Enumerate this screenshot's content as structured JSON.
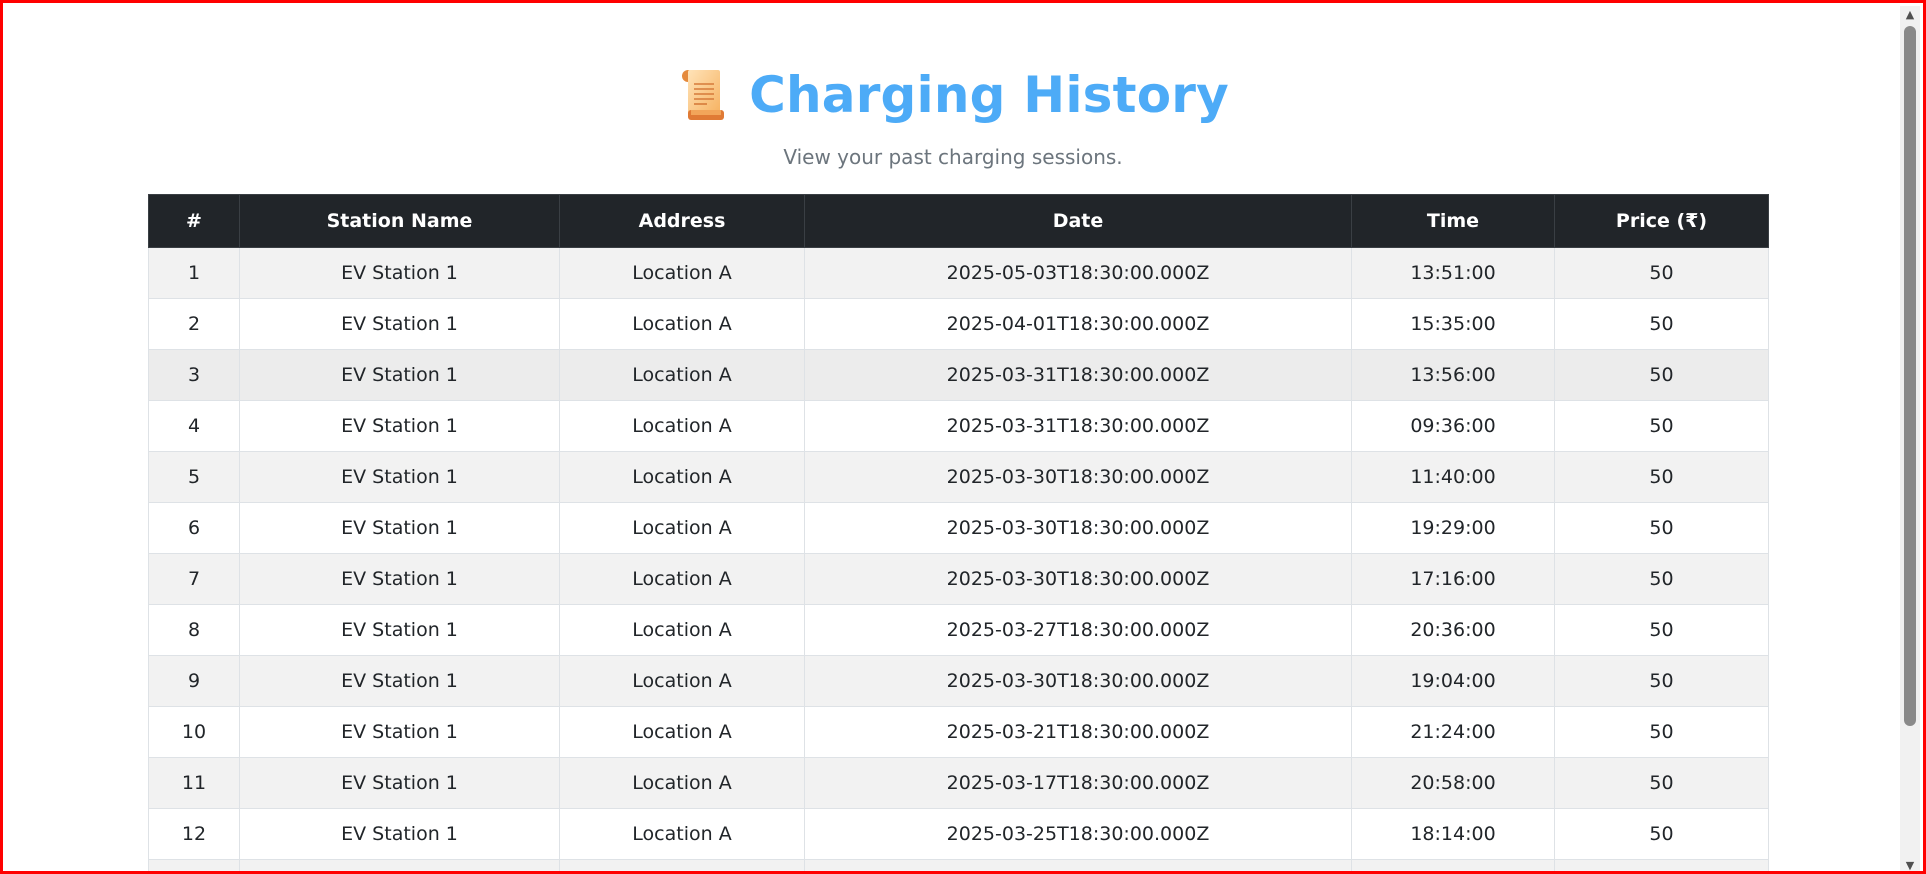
{
  "page": {
    "title": "Charging History",
    "subtitle": "View your past charging sessions.",
    "title_icon": "scroll-icon"
  },
  "table": {
    "columns": [
      "#",
      "Station Name",
      "Address",
      "Date",
      "Time",
      "Price (₹)"
    ],
    "rows": [
      {
        "num": "1",
        "station": "EV Station 1",
        "address": "Location A",
        "date": "2025-05-03T18:30:00.000Z",
        "time": "13:51:00",
        "price": "50"
      },
      {
        "num": "2",
        "station": "EV Station 1",
        "address": "Location A",
        "date": "2025-04-01T18:30:00.000Z",
        "time": "15:35:00",
        "price": "50"
      },
      {
        "num": "3",
        "station": "EV Station 1",
        "address": "Location A",
        "date": "2025-03-31T18:30:00.000Z",
        "time": "13:56:00",
        "price": "50"
      },
      {
        "num": "4",
        "station": "EV Station 1",
        "address": "Location A",
        "date": "2025-03-31T18:30:00.000Z",
        "time": "09:36:00",
        "price": "50"
      },
      {
        "num": "5",
        "station": "EV Station 1",
        "address": "Location A",
        "date": "2025-03-30T18:30:00.000Z",
        "time": "11:40:00",
        "price": "50"
      },
      {
        "num": "6",
        "station": "EV Station 1",
        "address": "Location A",
        "date": "2025-03-30T18:30:00.000Z",
        "time": "19:29:00",
        "price": "50"
      },
      {
        "num": "7",
        "station": "EV Station 1",
        "address": "Location A",
        "date": "2025-03-30T18:30:00.000Z",
        "time": "17:16:00",
        "price": "50"
      },
      {
        "num": "8",
        "station": "EV Station 1",
        "address": "Location A",
        "date": "2025-03-27T18:30:00.000Z",
        "time": "20:36:00",
        "price": "50"
      },
      {
        "num": "9",
        "station": "EV Station 1",
        "address": "Location A",
        "date": "2025-03-30T18:30:00.000Z",
        "time": "19:04:00",
        "price": "50"
      },
      {
        "num": "10",
        "station": "EV Station 1",
        "address": "Location A",
        "date": "2025-03-21T18:30:00.000Z",
        "time": "21:24:00",
        "price": "50"
      },
      {
        "num": "11",
        "station": "EV Station 1",
        "address": "Location A",
        "date": "2025-03-17T18:30:00.000Z",
        "time": "20:58:00",
        "price": "50"
      },
      {
        "num": "12",
        "station": "EV Station 1",
        "address": "Location A",
        "date": "2025-03-25T18:30:00.000Z",
        "time": "18:14:00",
        "price": "50"
      },
      {
        "num": "",
        "station": "",
        "address": "",
        "date": "",
        "time": "",
        "price": ""
      }
    ]
  },
  "colors": {
    "title": "#4dabf7",
    "table_header_bg": "#212529",
    "frame_border": "#ff0000"
  },
  "scrollbar": {
    "up_icon": "scroll-up-arrow-icon",
    "down_icon": "scroll-down-arrow-icon"
  }
}
